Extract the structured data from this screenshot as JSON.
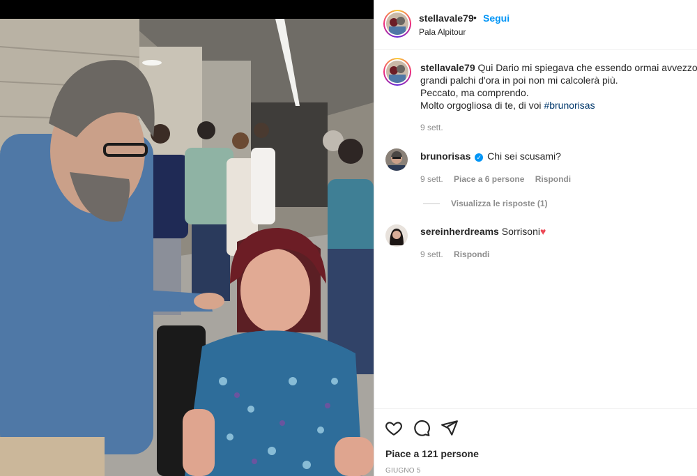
{
  "post": {
    "author": "stellavale79",
    "separator": "•",
    "follow_label": "Segui",
    "location": "Pala Alpitour",
    "image_alt": "Photo of a man with glasses and a denim shirt talking to a smiling woman in a floral dress in a backstage corridor full of people"
  },
  "caption": {
    "username": "stellavale79",
    "line1": "Qui Dario mi spiegava che essendo ormai avvezzo ai",
    "line2": "grandi palchi d'ora in poi non mi calcolerà più.",
    "line3": "Peccato, ma comprendo.",
    "line4": "Molto orgogliosa di te, di voi ",
    "hashtag": "#brunorisas",
    "time": "9 sett."
  },
  "comments": [
    {
      "username": "brunorisas",
      "verified": true,
      "text": "Chi sei scusami?",
      "time": "9 sett.",
      "likes": "Piace a 6 persone",
      "reply": "Rispondi",
      "view_replies": "Visualizza le risposte (1)"
    },
    {
      "username": "sereinherdreams",
      "text": "Sorrisoni",
      "time": "9 sett.",
      "reply": "Rispondi"
    }
  ],
  "footer": {
    "likes": "Piace a 121 persone",
    "date": "GIUGNO 5"
  },
  "icons": {
    "like": "heart-icon",
    "comment": "comment-icon",
    "share": "share-icon",
    "verified": "verified-badge-icon"
  },
  "colors": {
    "link": "#0095f6",
    "hashtag": "#00376b",
    "heart": "#ed4956",
    "muted": "#8e8e8e"
  }
}
